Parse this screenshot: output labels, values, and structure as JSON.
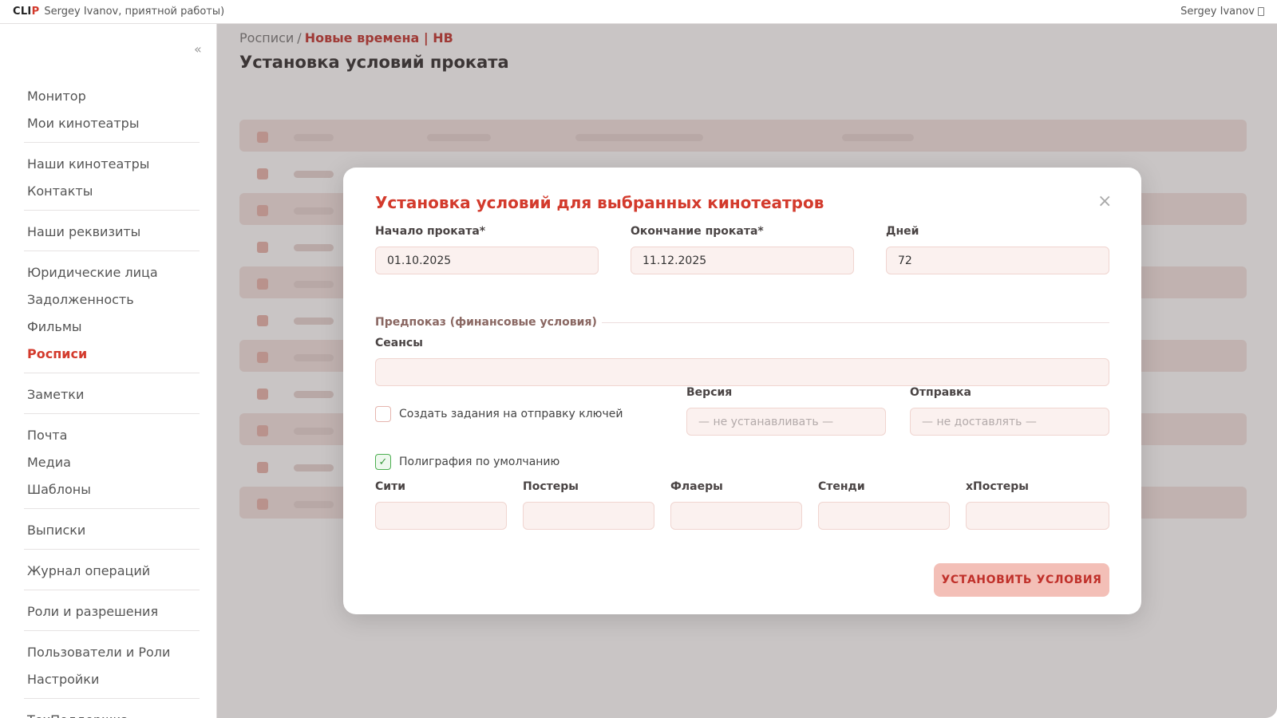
{
  "topbar": {
    "logo_part1": "CLI",
    "logo_part2": "P",
    "greeting": "Sergey Ivanov, приятной работы)",
    "user_name": "Sergey Ivanov"
  },
  "sidebar": {
    "collapse": "«",
    "groups": [
      [
        {
          "label": "Монитор"
        },
        {
          "label": "Мои кинотеатры"
        }
      ],
      [
        {
          "label": "Наши кинотеатры"
        },
        {
          "label": "Контакты"
        }
      ],
      [
        {
          "label": "Наши реквизиты"
        }
      ],
      [
        {
          "label": "Юридические лица"
        },
        {
          "label": "Задолженность"
        },
        {
          "label": "Фильмы"
        },
        {
          "label": "Росписи",
          "active": true
        }
      ],
      [
        {
          "label": "Заметки"
        }
      ],
      [
        {
          "label": "Почта"
        },
        {
          "label": "Медиа"
        },
        {
          "label": "Шаблоны"
        }
      ],
      [
        {
          "label": "Выписки"
        }
      ],
      [
        {
          "label": "Журнал операций"
        }
      ],
      [
        {
          "label": "Роли и разрешения"
        }
      ],
      [
        {
          "label": "Пользователи и Роли"
        },
        {
          "label": "Настройки"
        }
      ],
      [
        {
          "label": "ТехПоддержка"
        }
      ]
    ]
  },
  "main": {
    "breadcrumb_parent": "Росписи",
    "breadcrumb_sep": "/",
    "breadcrumb_current": "Новые времена | НВ",
    "title": "Установка условий проката"
  },
  "modal": {
    "title": "Установка условий для выбранных кинотеатров",
    "close": "×",
    "start_label": "Начало проката*",
    "start_value": "01.10.2025",
    "end_label": "Окончание проката*",
    "end_value": "11.12.2025",
    "days_label": "Дней",
    "days_value": "72",
    "section_title": "Предпоказ (финансовые условия)",
    "sessions_label": "Сеансы",
    "sessions_value": "",
    "keys_checkbox_label": "Создать задания на отправку ключей",
    "keys_checked": false,
    "version_label": "Версия",
    "version_placeholder": "— не устанавливать —",
    "delivery_label": "Отправка",
    "delivery_placeholder": "— не доставлять —",
    "printing_checkbox_label": "Полиграфия по умолчанию",
    "printing_checked": true,
    "printing_check_mark": "✓",
    "city_label": "Сити",
    "posters_label": "Постеры",
    "flyers_label": "Флаеры",
    "standees_label": "Стенди",
    "xposters_label": "хПостеры",
    "submit_label": "УСТАНОВИТЬ УСЛОВИЯ"
  },
  "colors": {
    "accent": "#d33a2c",
    "input_bg": "#fbf1ef",
    "submit_bg": "#f3bfb7",
    "check_green": "#4caf50"
  }
}
